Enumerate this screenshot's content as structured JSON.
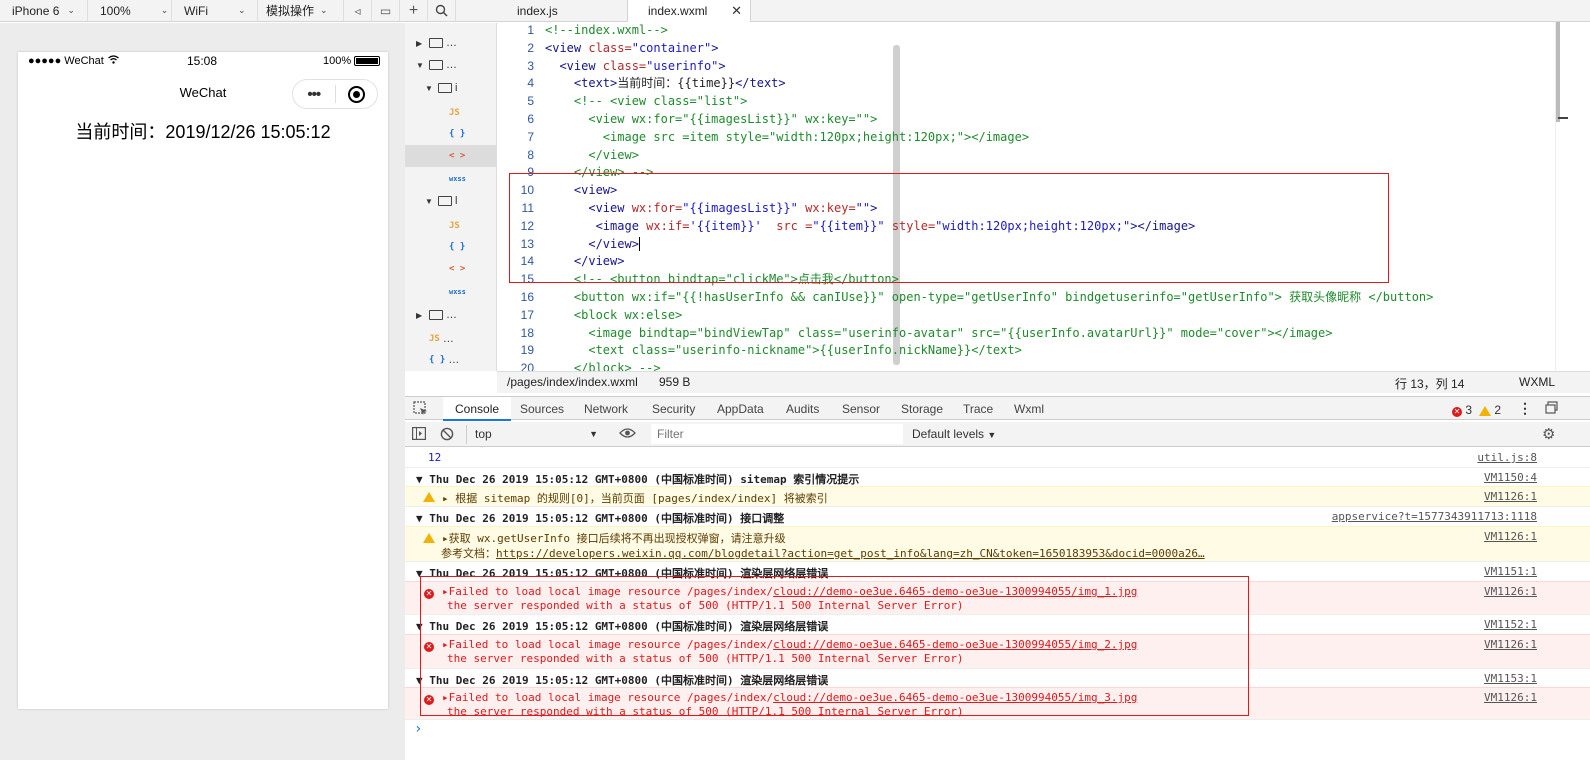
{
  "toolbar": {
    "device": "iPhone 6",
    "zoom": "100%",
    "network": "WiFi",
    "operation": "模拟操作"
  },
  "simulator": {
    "carrier": "●●●●● WeChat",
    "clock": "15:08",
    "battery": "100%",
    "nav_title": "WeChat",
    "current_time": "当前时间：2019/12/26 15:05:12"
  },
  "tree": {
    "rows": [
      {
        "label": "…"
      },
      {
        "label": "…"
      },
      {
        "label": "i"
      },
      {
        "label": "l"
      },
      {
        "label": "…"
      },
      {
        "label": "…"
      },
      {
        "label": "…"
      },
      {
        "label": "…"
      }
    ],
    "type_labels": {
      "js": "JS",
      "json": "{ }",
      "wxml": "< >",
      "wxss": "wxss"
    }
  },
  "editor": {
    "tabs": [
      {
        "label": "index.js"
      },
      {
        "label": "index.wxml"
      }
    ],
    "line_numbers": [
      "1",
      "2",
      "3",
      "4",
      "5",
      "6",
      "7",
      "8",
      "9",
      "10",
      "11",
      "12",
      "13",
      "14",
      "15",
      "16",
      "17",
      "18",
      "19",
      "20"
    ],
    "status": {
      "path": "/pages/index/index.wxml",
      "size": "959 B",
      "cursor": "行 13，列 14",
      "lang": "WXML"
    }
  },
  "devtools": {
    "tabs": [
      "Console",
      "Sources",
      "Network",
      "Security",
      "AppData",
      "Audits",
      "Sensor",
      "Storage",
      "Trace",
      "Wxml"
    ],
    "error_count": "3",
    "warn_count": "2",
    "context": "top",
    "filter_placeholder": "Filter",
    "levels": "Default levels",
    "console": {
      "log_value": "12",
      "log_src": "util.js:8",
      "g1_title": "Thu Dec 26 2019 15:05:12 GMT+0800 (中国标准时间) sitemap 索引情况提示",
      "g1_src": "VM1150:4",
      "w1_text": "▸ 根据 sitemap 的规则[0]，当前页面 [pages/index/index] 将被索引",
      "w1_src": "VM1126:1",
      "g2_title": "Thu Dec 26 2019 15:05:12 GMT+0800 (中国标准时间) 接口调整",
      "g2_src": "appservice?t=1577343911713:1118",
      "w2_line1": "▸获取 wx.getUserInfo 接口后续将不再出现授权弹窗，请注意升级",
      "w2_line2_prefix": "参考文档：",
      "w2_link": "https://developers.weixin.qq.com/blogdetail?action=get_post_info&lang=zh_CN&token=1650183953&docid=0000a26…",
      "w2_src": "VM1126:1",
      "errors": [
        {
          "title": "Thu Dec 26 2019 15:05:12 GMT+0800 (中国标准时间) 渲染层网络层错误",
          "group_src": "VM1151:1",
          "prefix": "▸Failed to load local image resource /pages/index/",
          "url": "cloud://demo-oe3ue.6465-demo-oe3ue-1300994055/img_1.jpg",
          "line2": "the server responded with a status of 500 (HTTP/1.1 500 Internal Server Error)",
          "src": "VM1126:1"
        },
        {
          "title": "Thu Dec 26 2019 15:05:12 GMT+0800 (中国标准时间) 渲染层网络层错误",
          "group_src": "VM1152:1",
          "prefix": "▸Failed to load local image resource /pages/index/",
          "url": "cloud://demo-oe3ue.6465-demo-oe3ue-1300994055/img_2.jpg",
          "line2": "the server responded with a status of 500 (HTTP/1.1 500 Internal Server Error)",
          "src": "VM1126:1"
        },
        {
          "title": "Thu Dec 26 2019 15:05:12 GMT+0800 (中国标准时间) 渲染层网络层错误",
          "group_src": "VM1153:1",
          "prefix": "▸Failed to load local image resource /pages/index/",
          "url": "cloud://demo-oe3ue.6465-demo-oe3ue-1300994055/img_3.jpg",
          "line2": "the server responded with a status of 500 (HTTP/1.1 500 Internal Server Error)",
          "src": "VM1126:1"
        }
      ],
      "prompt": "›"
    }
  },
  "code_lines": [
    [
      {
        "t": "<!--index.wxml-->",
        "c": "cm"
      }
    ],
    [
      {
        "t": "<view ",
        "c": "tag"
      },
      {
        "t": "class=",
        "c": "at"
      },
      {
        "t": "\"container\"",
        "c": "st"
      },
      {
        "t": ">",
        "c": "tag"
      }
    ],
    [
      {
        "t": "  <view ",
        "c": "tag"
      },
      {
        "t": "class=",
        "c": "at"
      },
      {
        "t": "\"userinfo\"",
        "c": "st"
      },
      {
        "t": ">",
        "c": "tag"
      }
    ],
    [
      {
        "t": "    <text>",
        "c": "tag"
      },
      {
        "t": "当前时间：{{time}}",
        "c": "tx"
      },
      {
        "t": "</text>",
        "c": "tag"
      }
    ],
    [
      {
        "t": "    <!-- <view class=\"list\">",
        "c": "cm"
      }
    ],
    [
      {
        "t": "      <view wx:for=\"{{imagesList}}\" wx:key=\"\">",
        "c": "cm"
      }
    ],
    [
      {
        "t": "        <image src =item style=\"width:120px;height:120px;\"></image>",
        "c": "cm"
      }
    ],
    [
      {
        "t": "      </view>",
        "c": "cm"
      }
    ],
    [
      {
        "t": "    </view> -->",
        "c": "cm"
      }
    ],
    [
      {
        "t": "    <view>",
        "c": "tag"
      }
    ],
    [
      {
        "t": "      <view ",
        "c": "tag"
      },
      {
        "t": "wx:for=",
        "c": "at"
      },
      {
        "t": "\"{{imagesList}}\"",
        "c": "st"
      },
      {
        "t": " wx:key=",
        "c": "at"
      },
      {
        "t": "\"\"",
        "c": "st"
      },
      {
        "t": ">",
        "c": "tag"
      }
    ],
    [
      {
        "t": "       <image ",
        "c": "tag"
      },
      {
        "t": "wx:if=",
        "c": "at"
      },
      {
        "t": "'{{item}}'",
        "c": "st"
      },
      {
        "t": "  src =",
        "c": "at"
      },
      {
        "t": "\"{{item}}\"",
        "c": "st"
      },
      {
        "t": " style=",
        "c": "at"
      },
      {
        "t": "\"width:120px;height:120px;\"",
        "c": "st"
      },
      {
        "t": "></image>",
        "c": "tag"
      }
    ],
    [
      {
        "t": "      </view>",
        "c": "tag"
      }
    ],
    [
      {
        "t": "    </view>",
        "c": "tag"
      }
    ],
    [
      {
        "t": "    <!-- <button bindtap=\"clickMe\">点击我</button>",
        "c": "cm"
      }
    ],
    [
      {
        "t": "    <button wx:if=\"{{!hasUserInfo && canIUse}}\" open-type=\"getUserInfo\" bindgetuserinfo=\"getUserInfo\"> 获取头像昵称 </button>",
        "c": "cm"
      }
    ],
    [
      {
        "t": "    <block wx:else>",
        "c": "cm"
      }
    ],
    [
      {
        "t": "      <image bindtap=\"bindViewTap\" class=\"userinfo-avatar\" src=\"{{userInfo.avatarUrl}}\" mode=\"cover\"></image>",
        "c": "cm"
      }
    ],
    [
      {
        "t": "      <text class=\"userinfo-nickname\">{{userInfo.nickName}}</text>",
        "c": "cm"
      }
    ],
    [
      {
        "t": "    </block> -->",
        "c": "cm"
      }
    ]
  ]
}
